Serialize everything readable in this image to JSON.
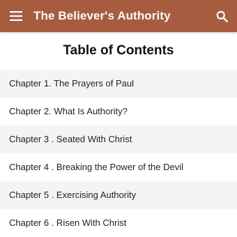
{
  "appbar": {
    "title": "The Believer's Authority",
    "menu_icon": "hamburger-menu-icon",
    "search_icon": "search-icon",
    "color": "#a85c3f"
  },
  "toc": {
    "heading": "Table of Contents",
    "items": [
      {
        "label": "Chapter 1. The Prayers of Paul"
      },
      {
        "label": "Chapter 2. What Is Authority?"
      },
      {
        "label": "Chapter 3 . Seated With Christ"
      },
      {
        "label": "Chapter 4 . Breaking the Power of the Devil"
      },
      {
        "label": "Chapter 5 . Exercising Authority"
      },
      {
        "label": "Chapter 6 . Risen With Christ"
      }
    ]
  }
}
